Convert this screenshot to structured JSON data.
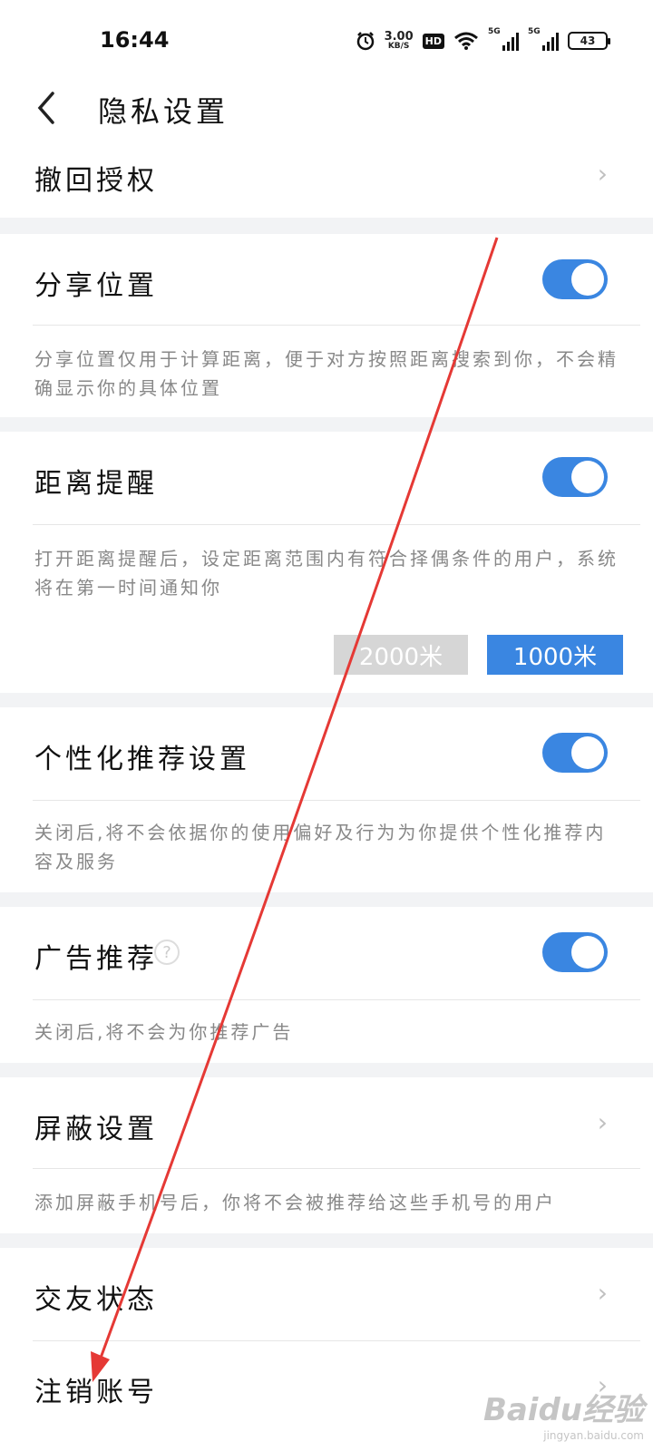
{
  "status_bar": {
    "time": "16:44",
    "net_speed_value": "3.00",
    "net_speed_unit": "KB/S",
    "hd_label": "HD",
    "sim1_tag": "5G",
    "sim2_tag": "5G",
    "battery_level": "43",
    "icons": [
      "alarm-icon",
      "wifi-icon",
      "signal-icon",
      "signal-icon",
      "battery-icon"
    ]
  },
  "header": {
    "title": "隐私设置"
  },
  "rows": {
    "revoke": {
      "title": "撤回授权"
    },
    "share_location": {
      "title": "分享位置",
      "desc": "分享位置仅用于计算距离，便于对方按照距离搜索到你，不会精 确显示你的具体位置",
      "toggle_on": true
    },
    "distance_reminder": {
      "title": "距离提醒",
      "desc": "打开距离提醒后，设定距离范围内有符合择偶条件的用户，系统 将在第一时间通知你",
      "toggle_on": true,
      "options": [
        "2000米",
        "1000米"
      ],
      "selected": "1000米"
    },
    "personalized": {
      "title": "个性化推荐设置",
      "desc": "关闭后,将不会依据你的使用偏好及行为为你提供个性化推荐内容及服务",
      "toggle_on": true
    },
    "ads": {
      "title": "广告推荐",
      "help_glyph": "?",
      "desc": "关闭后,将不会为你推荐广告",
      "toggle_on": true
    },
    "block": {
      "title": "屏蔽设置",
      "desc": "添加屏蔽手机号后，你将不会被推荐给这些手机号的用户"
    },
    "friend_status": {
      "title": "交友状态"
    },
    "delete_account": {
      "title": "注销账号"
    }
  },
  "colors": {
    "accent": "#3a86e1",
    "toggle_on": "#3a86e1",
    "option_inactive": "#d6d6d6",
    "annotation_arrow": "#e53935",
    "page_bg": "#f2f3f5"
  },
  "watermark": {
    "brand": "Baidu经验",
    "url": "jingyan.baidu.com"
  }
}
